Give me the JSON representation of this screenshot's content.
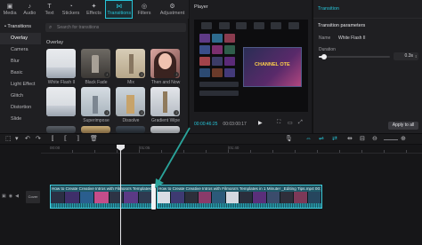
{
  "media_tabs": [
    {
      "label": "Media",
      "icon": "media-icon",
      "glyph": "▣"
    },
    {
      "label": "Audio",
      "icon": "audio-icon",
      "glyph": "♪"
    },
    {
      "label": "Text",
      "icon": "text-icon",
      "glyph": "T"
    },
    {
      "label": "Stickers",
      "icon": "stickers-icon",
      "glyph": "◔"
    },
    {
      "label": "Effects",
      "icon": "effects-icon",
      "glyph": "✦"
    },
    {
      "label": "Transitions",
      "icon": "transitions-icon",
      "glyph": "⋈"
    },
    {
      "label": "Filters",
      "icon": "filters-icon",
      "glyph": "◎"
    },
    {
      "label": "Adjustment",
      "icon": "adjustment-icon",
      "glyph": "⚙"
    }
  ],
  "categories": {
    "parent": "• Transitions",
    "items": [
      "Overlay",
      "Camera",
      "Blur",
      "Basic",
      "Light Effect",
      "Glitch",
      "Distortion",
      "Slide"
    ],
    "selected": "Overlay"
  },
  "search_placeholder": "Search for transitions",
  "section_title": "Overlay",
  "tiles_row1": [
    "White Flash II",
    "Black Fade",
    "Mix",
    "Then and Now"
  ],
  "tiles_row2": [
    "",
    "Superimpose",
    "Dissolve",
    "Gradient Wipe"
  ],
  "player": {
    "title": "Player",
    "current_time": "00:00:46:25",
    "total_time": "00:03:00:17",
    "overlay_text": "CHANNEL OTE"
  },
  "right_panel": {
    "tab": "Transition",
    "header": "Transition parameters",
    "name_label": "Name",
    "name_value": "White Flash II",
    "duration_label": "Duration",
    "duration_value": "0.3s",
    "duration_fraction": 0.08,
    "apply_label": "Apply to all"
  },
  "timeline": {
    "ruler_labels": [
      "00:00",
      "|01:05",
      "|01:40"
    ],
    "clip1_title": "How to Create Creative Intros with Filmora's Templates in",
    "clip2_title": "How to Create Creative Intros with Filmora's Templates in 1 Minute! _Editing Tips.mp4  00:01:5",
    "cover_label": "Cover"
  },
  "colors": {
    "accent": "#27c4d8",
    "clip": "#1c3c46",
    "clip_border": "#3fd0e0",
    "arrow": "#2aa39a"
  }
}
